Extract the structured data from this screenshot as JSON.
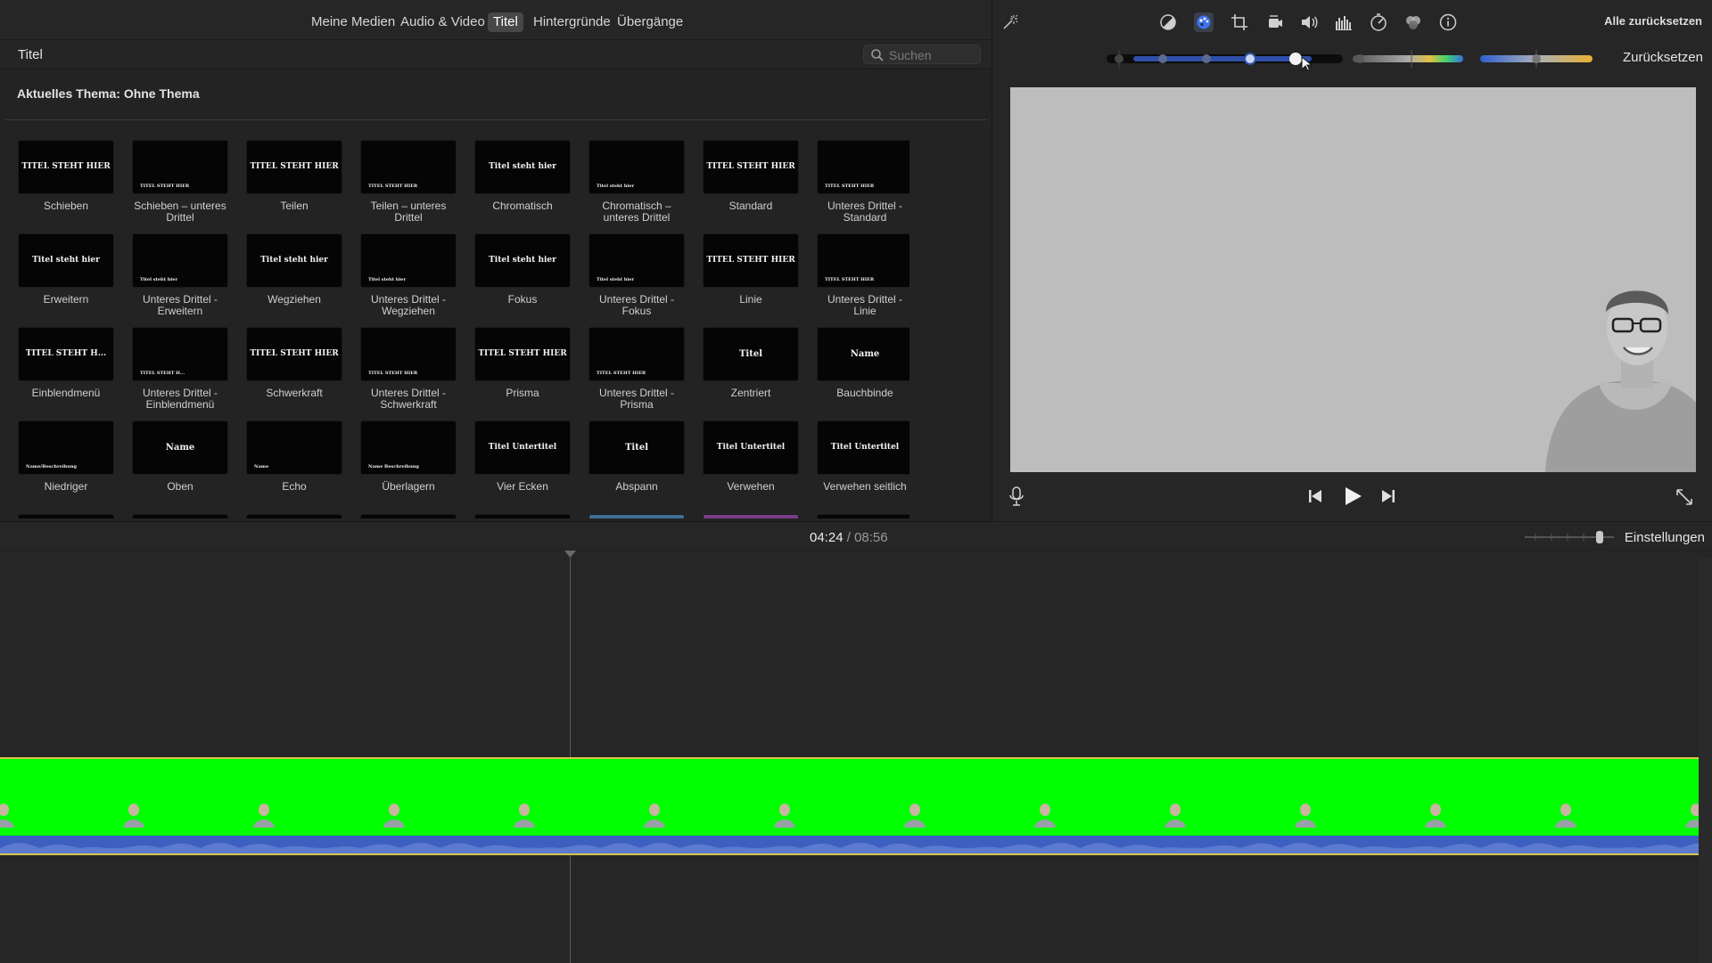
{
  "browser": {
    "tabs": [
      {
        "label": "Meine Medien",
        "active": false
      },
      {
        "label": "Audio & Video",
        "active": false
      },
      {
        "label": "Titel",
        "active": true
      },
      {
        "label": "Hintergründe",
        "active": false
      },
      {
        "label": "Übergänge",
        "active": false
      }
    ],
    "title": "Titel",
    "search_placeholder": "Suchen",
    "theme_label": "Aktuelles Thema: Ohne Thema",
    "titles": [
      {
        "label": "Schieben",
        "thumb_text": "TITEL STEHT HIER"
      },
      {
        "label": "Schieben – unteres Drittel",
        "thumb_text": "TITEL STEHT HIER"
      },
      {
        "label": "Teilen",
        "thumb_text": "TITEL STEHT HIER"
      },
      {
        "label": "Teilen – unteres Drittel",
        "thumb_text": "TITEL STEHT HIER"
      },
      {
        "label": "Chromatisch",
        "thumb_text": "Titel steht hier"
      },
      {
        "label": "Chromatisch – unteres Drittel",
        "thumb_text": "Titel steht hier"
      },
      {
        "label": "Standard",
        "thumb_text": "TITEL STEHT HIER"
      },
      {
        "label": "Unteres Drittel - Standard",
        "thumb_text": "TITEL STEHT HIER"
      },
      {
        "label": "Erweitern",
        "thumb_text": "Titel steht hier"
      },
      {
        "label": "Unteres Drittel - Erweitern",
        "thumb_text": "Titel steht hier"
      },
      {
        "label": "Wegziehen",
        "thumb_text": "Titel steht hier"
      },
      {
        "label": "Unteres Drittel - Wegziehen",
        "thumb_text": "Titel steht hier"
      },
      {
        "label": "Fokus",
        "thumb_text": "Titel steht hier"
      },
      {
        "label": "Unteres Drittel - Fokus",
        "thumb_text": "Titel steht hier"
      },
      {
        "label": "Linie",
        "thumb_text": "TITEL STEHT HIER"
      },
      {
        "label": "Unteres Drittel - Linie",
        "thumb_text": "TITEL STEHT HIER"
      },
      {
        "label": "Einblendmenü",
        "thumb_text": "TITEL STEHT H..."
      },
      {
        "label": "Unteres Drittel - Einblendmenü",
        "thumb_text": "TITEL STEHT H..."
      },
      {
        "label": "Schwerkraft",
        "thumb_text": "TITEL STEHT HIER"
      },
      {
        "label": "Unteres Drittel - Schwerkraft",
        "thumb_text": "TITEL STEHT HIER"
      },
      {
        "label": "Prisma",
        "thumb_text": "TITEL STEHT HIER"
      },
      {
        "label": "Unteres Drittel - Prisma",
        "thumb_text": "TITEL STEHT HIER"
      },
      {
        "label": "Zentriert",
        "thumb_text": "Titel"
      },
      {
        "label": "Bauchbinde",
        "thumb_text": "Name"
      },
      {
        "label": "Niedriger",
        "thumb_text": "Name/Beschreibung"
      },
      {
        "label": "Oben",
        "thumb_text": "Name"
      },
      {
        "label": "Echo",
        "thumb_text": "Name"
      },
      {
        "label": "Überlagern",
        "thumb_text": "Name Beschreibung"
      },
      {
        "label": "Vier Ecken",
        "thumb_text": "Titel Untertitel"
      },
      {
        "label": "Abspann",
        "thumb_text": "Titel"
      },
      {
        "label": "Verwehen",
        "thumb_text": "Titel Untertitel"
      },
      {
        "label": "Verwehen seitlich",
        "thumb_text": "Titel Untertitel"
      }
    ]
  },
  "viewer": {
    "reset_all_label": "Alle zurücksetzen",
    "reset_label": "Zurücksetzen",
    "tools": [
      "magic-wand-icon",
      "color-balance-icon",
      "color-correction-icon",
      "crop-icon",
      "stabilization-icon",
      "volume-icon",
      "noise-reduction-icon",
      "speed-icon",
      "clip-filter-icon",
      "info-icon"
    ],
    "active_tool": "color-correction-icon",
    "accent_color": "#3d73e8"
  },
  "timeline": {
    "current_time": "04:24",
    "separator": "/",
    "duration": "08:56",
    "settings_label": "Einstellungen",
    "clip_color": "#00ff00",
    "audio_color": "#3d5fbf"
  }
}
